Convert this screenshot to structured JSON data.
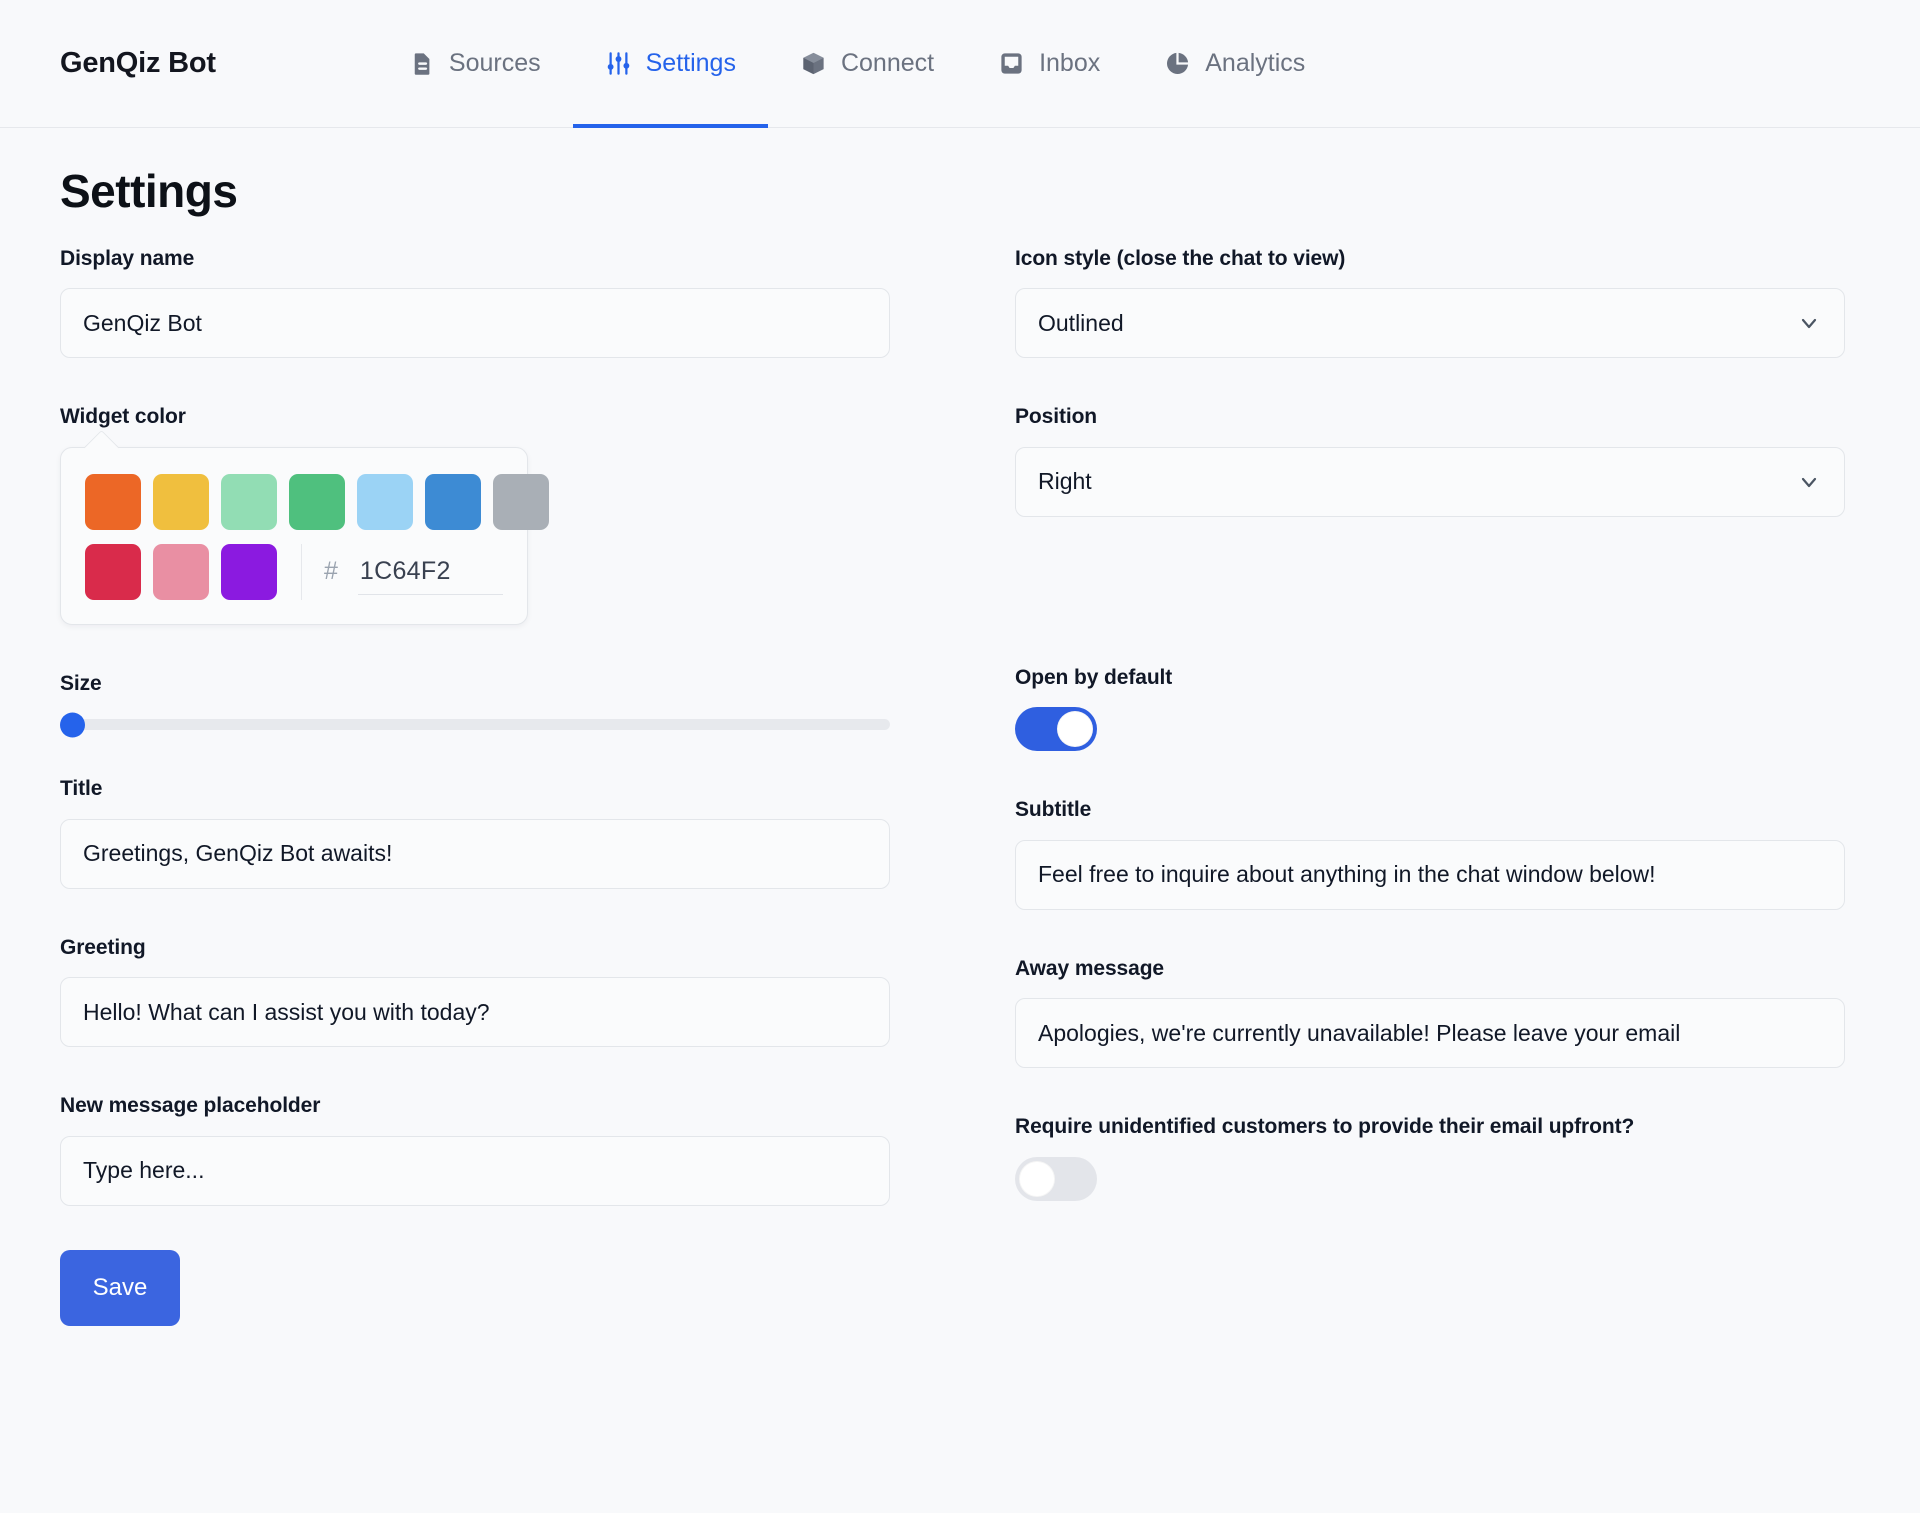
{
  "header": {
    "brand": "GenQiz Bot",
    "nav": [
      {
        "label": "Sources",
        "icon": "document-icon",
        "active": false
      },
      {
        "label": "Settings",
        "icon": "sliders-icon",
        "active": true
      },
      {
        "label": "Connect",
        "icon": "cube-icon",
        "active": false
      },
      {
        "label": "Inbox",
        "icon": "inbox-icon",
        "active": false
      },
      {
        "label": "Analytics",
        "icon": "pie-chart-icon",
        "active": false
      }
    ]
  },
  "page": {
    "title": "Settings"
  },
  "left": {
    "display_name": {
      "label": "Display name",
      "value": "GenQiz Bot"
    },
    "widget_color": {
      "label": "Widget color",
      "hash": "#",
      "hex_value": "1C64F2",
      "swatches_row1": [
        "#EC6726",
        "#F0BF3E",
        "#92DDB4",
        "#4FC07E",
        "#9BD3F5",
        "#3D8BD4",
        "#A9AFB6"
      ],
      "swatches_row2": [
        "#DB2murky",
        "#E98FA3",
        "#8B1AE0"
      ]
    },
    "size": {
      "label": "Size",
      "value": 0,
      "min": 0,
      "max": 100
    },
    "title_field": {
      "label": "Title",
      "value": "Greetings, GenQiz Bot awaits!"
    },
    "greeting": {
      "label": "Greeting",
      "value": "Hello! What can I assist you with today?"
    },
    "new_message_placeholder": {
      "label": "New message placeholder",
      "value": "Type here..."
    },
    "save_label": "Save"
  },
  "right": {
    "icon_style": {
      "label": "Icon style (close the chat to view)",
      "value": "Outlined"
    },
    "position": {
      "label": "Position",
      "value": "Right"
    },
    "open_by_default": {
      "label": "Open by default",
      "state": "on"
    },
    "subtitle": {
      "label": "Subtitle",
      "value": "Feel free to inquire about anything in the chat window below!"
    },
    "away_message": {
      "label": "Away message",
      "value": "Apologies, we're currently unavailable! Please leave your email"
    },
    "require_email": {
      "label": "Require unidentified customers to provide their email upfront?",
      "state": "off"
    }
  },
  "colors": {
    "accent": "#2563eb",
    "toggle_on": "#2f5fe0",
    "save_bg": "#3b65e0",
    "swatch_1": "#EC6726",
    "swatch_2": "#F0BF3E",
    "swatch_3": "#92DDB4",
    "swatch_4": "#4FC07E",
    "swatch_5": "#9BD3F5",
    "swatch_6": "#3D8BD4",
    "swatch_7": "#A9AFB6",
    "swatch_8": "#D92B4B",
    "swatch_9": "#E98FA3",
    "swatch_10": "#8B1AE0"
  }
}
